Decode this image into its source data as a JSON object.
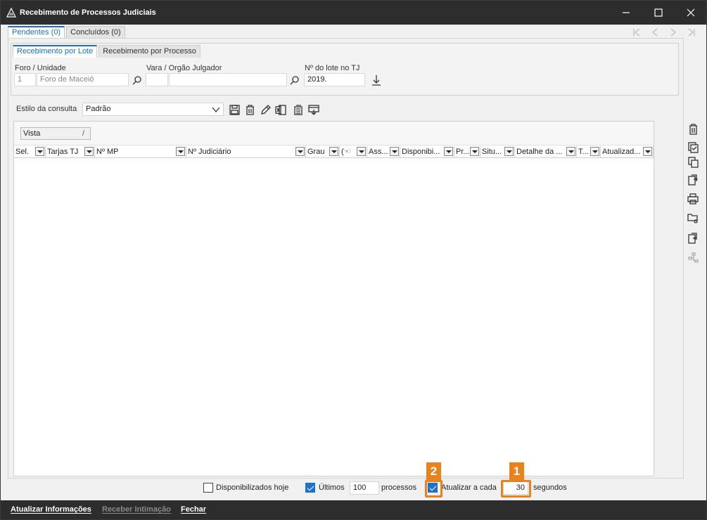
{
  "window": {
    "title": "Recebimento de Processos Judiciais",
    "controls": [
      "minimize-icon",
      "maximize-icon",
      "close-icon"
    ]
  },
  "top_tabs": [
    {
      "label": "Pendentes (0)",
      "active": true
    },
    {
      "label": "Concluídos (0)",
      "active": false
    }
  ],
  "record_nav": [
    "first-record-icon",
    "previous-record-icon",
    "next-record-icon",
    "last-record-icon"
  ],
  "filter": {
    "tabs": [
      {
        "label": "Recebimento por Lote",
        "active": true
      },
      {
        "label": "Recebimento por Processo",
        "active": false
      }
    ],
    "foro_label": "Foro / Unidade",
    "foro_code": "1",
    "foro_name": "Foro de Maceió",
    "vara_label": "Vara / Orgão Julgador",
    "vara_code": "",
    "vara_name": "",
    "lote_label": "Nº do lote no TJ",
    "lote_value": "2019."
  },
  "style_bar": {
    "label": "Estilo da consulta",
    "selected": "Padrão",
    "icons": [
      "save-icon",
      "delete-icon",
      "edit-icon",
      "excel-icon",
      "copy-icon",
      "export-icon"
    ]
  },
  "grid": {
    "group_button": "Vista",
    "group_button_sort": "/",
    "columns": [
      "Sel.",
      "Tarjas TJ",
      "Nº MP",
      "Nº Judiciário",
      "Grau",
      "(☜",
      "Ass...",
      "Disponibi...",
      "Pr...",
      "Situ...",
      "Detalhe da ...",
      "T...",
      "Atualizad..."
    ]
  },
  "right_toolbar": [
    "trash-icon",
    "check-doc-icon",
    "copy-doc-icon",
    "transfer-doc-icon",
    "print-icon",
    "folder-settings-icon",
    "export-doc-icon",
    "tree-icon"
  ],
  "options": {
    "disponibilizados_label": "Disponibilizados hoje",
    "disponibilizados_checked": false,
    "ultimos_label": "Últimos",
    "ultimos_checked": true,
    "ultimos_value": "100",
    "processos_label": "processos",
    "atualizar_label": "Atualizar a cada",
    "atualizar_checked": true,
    "atualizar_value": "30",
    "segundos_label": "segundos"
  },
  "callouts": {
    "one": "1",
    "two": "2",
    "color": "#e9821c"
  },
  "footer": {
    "atualizar": "Atualizar Informações",
    "receber": "Receber Intimação",
    "fechar": "Fechar"
  },
  "colors": {
    "accent": "#1a73c8",
    "titlebar": "#2d2d2d"
  }
}
